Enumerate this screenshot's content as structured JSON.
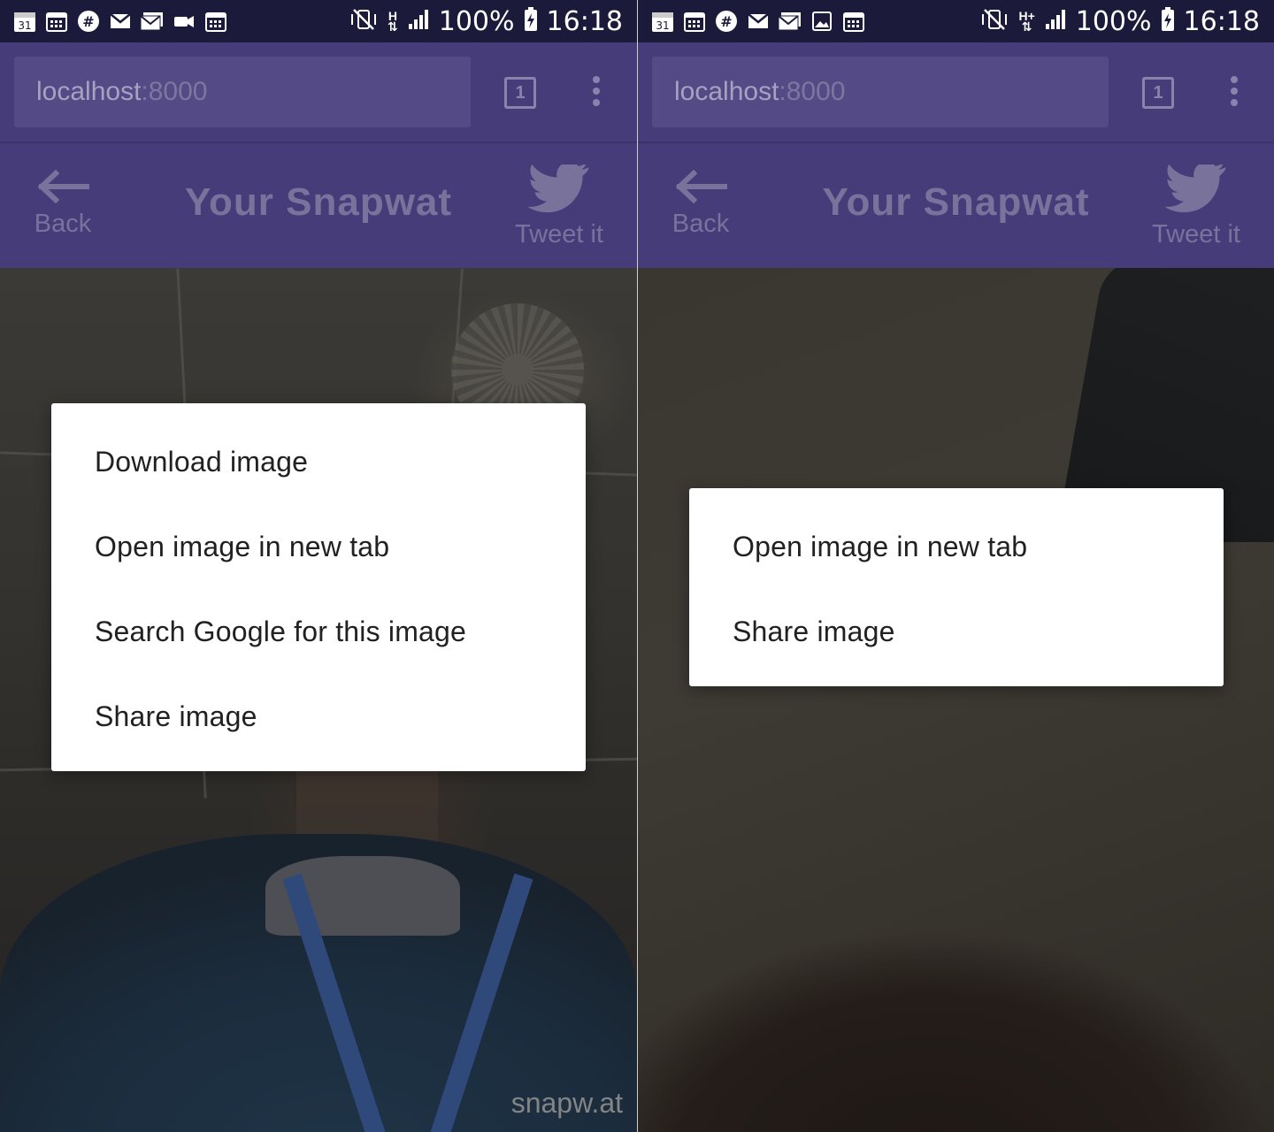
{
  "status_bar": {
    "battery": "100%",
    "time": "16:18",
    "network_left": "H",
    "network_right": "H+",
    "calendar_date": "31"
  },
  "browser": {
    "url_host": "localhost",
    "url_port": ":8000",
    "tab_count": "1"
  },
  "header": {
    "back_label": "Back",
    "title": "Your Snapwat",
    "tweet_label": "Tweet it"
  },
  "watermark": "snapw.at",
  "left_menu": {
    "items": [
      {
        "label": "Download image"
      },
      {
        "label": "Open image in new tab"
      },
      {
        "label": "Search Google for this image"
      },
      {
        "label": "Share image"
      }
    ]
  },
  "right_menu": {
    "items": [
      {
        "label": "Open image in new tab"
      },
      {
        "label": "Share image"
      }
    ]
  },
  "colors": {
    "statusbar": "#1c1a3a",
    "toolbar": "#463c7a",
    "menu_bg": "#ffffff",
    "menu_text": "#212121"
  }
}
